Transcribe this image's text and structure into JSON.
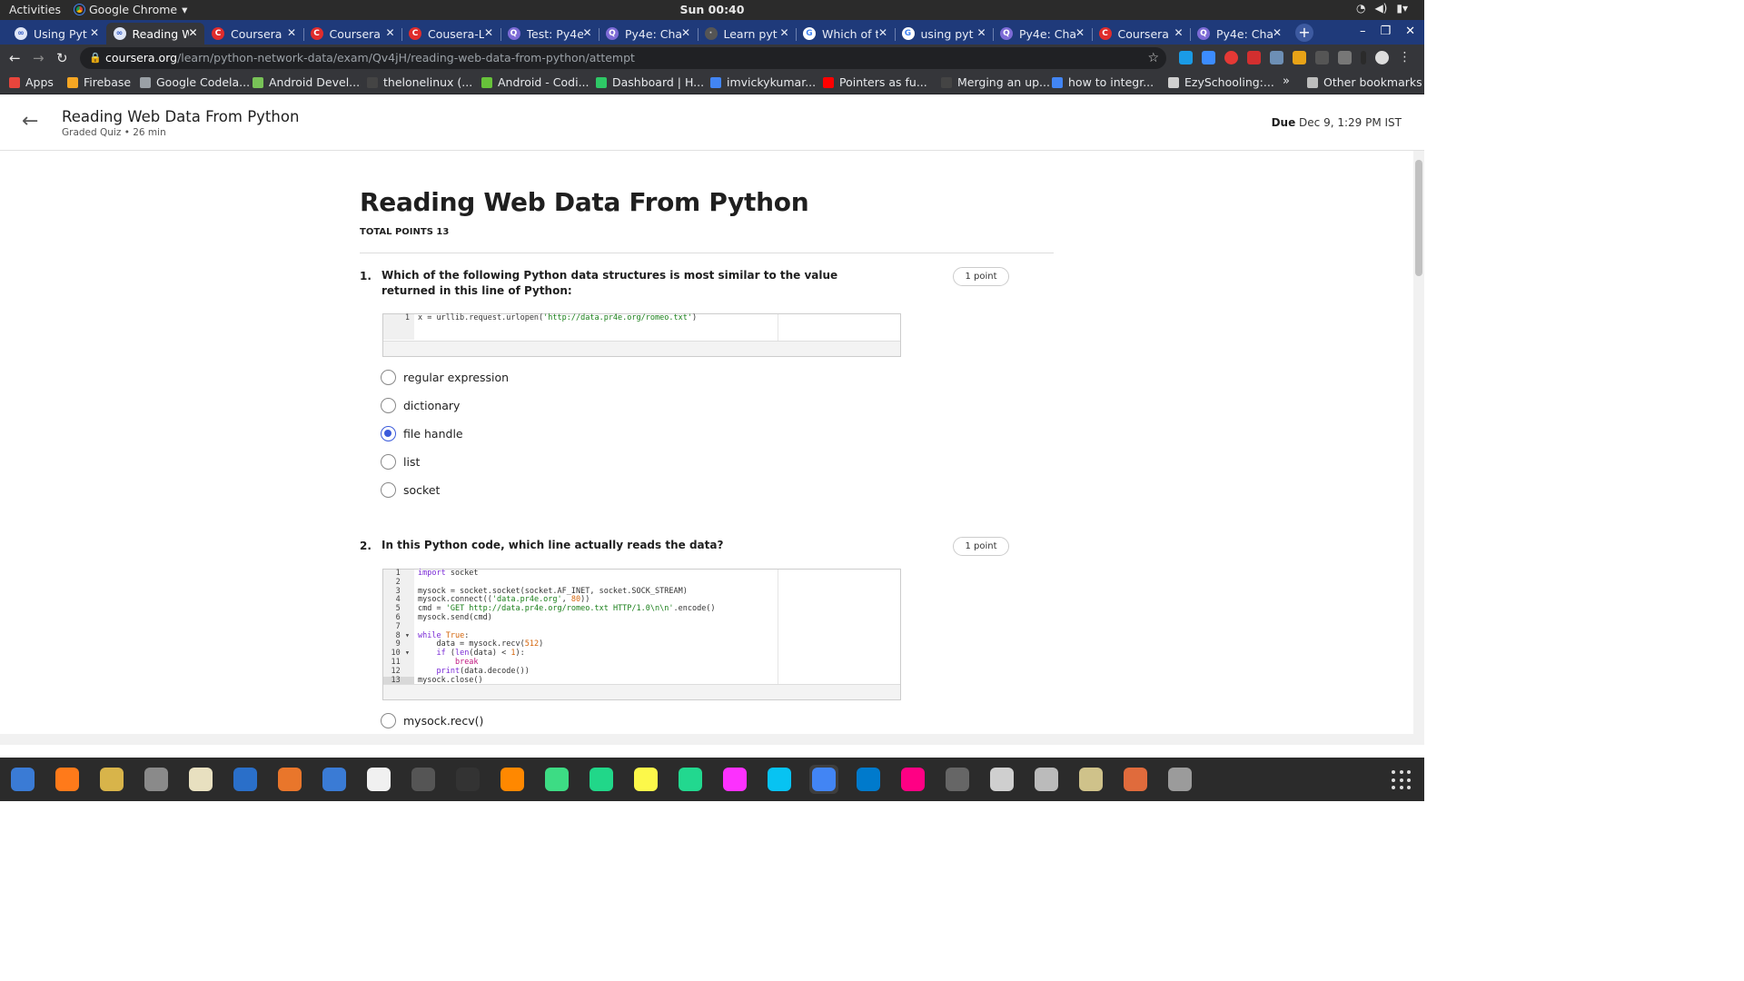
{
  "os": {
    "activities": "Activities",
    "app_name": "Google Chrome",
    "clock": "Sun 00:40"
  },
  "tabs": [
    {
      "label": "Using Pyt",
      "icon": "coursera-infinity-icon",
      "active": false
    },
    {
      "label": "Reading W",
      "icon": "coursera-infinity-icon",
      "active": true
    },
    {
      "label": "Coursera",
      "icon": "coursera-c-icon",
      "active": false
    },
    {
      "label": "Coursera",
      "icon": "coursera-c-icon",
      "active": false
    },
    {
      "label": "Cousera-L",
      "icon": "coursera-c-icon",
      "active": false
    },
    {
      "label": "Test: Py4e",
      "icon": "quiz-q-icon",
      "active": false
    },
    {
      "label": "Py4e: Cha",
      "icon": "quiz-q-icon",
      "active": false
    },
    {
      "label": "Learn pyt",
      "icon": "code-icon",
      "active": false
    },
    {
      "label": "Which of t",
      "icon": "google-icon",
      "active": false
    },
    {
      "label": "using pyt",
      "icon": "google-icon",
      "active": false
    },
    {
      "label": "Py4e: Cha",
      "icon": "quiz-q-icon",
      "active": false
    },
    {
      "label": "Coursera",
      "icon": "coursera-c-icon",
      "active": false
    },
    {
      "label": "Py4e: Cha",
      "icon": "quiz-q-icon",
      "active": false
    }
  ],
  "omnibox": {
    "host": "coursera.org",
    "path": "/learn/python-network-data/exam/Qv4jH/reading-web-data-from-python/attempt"
  },
  "bookmarks": {
    "items": [
      {
        "label": "Apps",
        "icon": "apps-grid-icon",
        "color": "#e8453c"
      },
      {
        "label": "Firebase",
        "icon": "firebase-icon",
        "color": "#f5a623"
      },
      {
        "label": "Google Codela...",
        "icon": "codelab-icon",
        "color": "#9aa0a6"
      },
      {
        "label": "Android Devel...",
        "icon": "android-icon",
        "color": "#78c257"
      },
      {
        "label": "thelonelinux (...",
        "icon": "github-icon",
        "color": "#444"
      },
      {
        "label": "Android - Codi...",
        "icon": "codinghub-icon",
        "color": "#67c23a"
      },
      {
        "label": "Dashboard | H...",
        "icon": "hackerearth-icon",
        "color": "#2ec866"
      },
      {
        "label": "imvickykumar...",
        "icon": "stats-icon",
        "color": "#4285f4"
      },
      {
        "label": "Pointers as fu...",
        "icon": "youtube-icon",
        "color": "#ff0000"
      },
      {
        "label": "Merging an up...",
        "icon": "github-icon",
        "color": "#444"
      },
      {
        "label": "how to integr...",
        "icon": "google-icon",
        "color": "#4285f4"
      },
      {
        "label": "EzySchooling:...",
        "icon": "ezyschooling-icon",
        "color": "#cfcfcf"
      }
    ],
    "more": "»",
    "other": "Other bookmarks"
  },
  "header": {
    "title": "Reading Web Data From Python",
    "subtitle": "Graded Quiz • 26 min",
    "due_label": "Due",
    "due_value": "Dec 9, 1:29 PM IST"
  },
  "quiz": {
    "title": "Reading Web Data From Python",
    "total_points": "TOTAL POINTS 13",
    "questions": [
      {
        "number": "1.",
        "text": "Which of the following Python data structures is most similar to the value returned in this line of Python:",
        "points": "1 point",
        "code_lines": [
          "x = urllib.request.urlopen('http://data.pr4e.org/romeo.txt')"
        ],
        "options": [
          "regular expression",
          "dictionary",
          "file handle",
          "list",
          "socket"
        ],
        "selected_option": "file handle"
      },
      {
        "number": "2.",
        "text": "In this Python code, which line actually reads the data?",
        "points": "1 point",
        "code_lines": [
          "import socket",
          "",
          "mysock = socket.socket(socket.AF_INET, socket.SOCK_STREAM)",
          "mysock.connect(('data.pr4e.org', 80))",
          "cmd = 'GET http://data.pr4e.org/romeo.txt HTTP/1.0\\n\\n'.encode()",
          "mysock.send(cmd)",
          "",
          "while True:",
          "    data = mysock.recv(512)",
          "    if (len(data) < 1):",
          "        break",
          "    print(data.decode())",
          "mysock.close()"
        ],
        "fold_lines": [
          8,
          10
        ],
        "options": [
          "mysock.recv()"
        ]
      }
    ]
  },
  "dock": {
    "apps": [
      {
        "icon": "thunderbird-icon",
        "color": "#3a7bd5"
      },
      {
        "icon": "firefox-icon",
        "color": "#ff7a1a"
      },
      {
        "icon": "rhythmbox-icon",
        "color": "#d8b44a"
      },
      {
        "icon": "files-icon",
        "color": "#8a8a8a"
      },
      {
        "icon": "text-editor-icon",
        "color": "#e8e0c0"
      },
      {
        "icon": "libreoffice-writer-icon",
        "color": "#2a6fc9"
      },
      {
        "icon": "software-center-icon",
        "color": "#e9762b"
      },
      {
        "icon": "help-icon",
        "color": "#3a7bd5"
      },
      {
        "icon": "amazon-icon",
        "color": "#f0f0f0"
      },
      {
        "icon": "video-editor-icon",
        "color": "#555"
      },
      {
        "icon": "terminal-icon",
        "color": "#333"
      },
      {
        "icon": "vlc-icon",
        "color": "#ff8800"
      },
      {
        "icon": "android-studio-icon",
        "color": "#3ddc84"
      },
      {
        "icon": "pycharm-icon",
        "color": "#21d789"
      },
      {
        "icon": "pycharm-pro-icon",
        "color": "#fcf84a"
      },
      {
        "icon": "clion-icon",
        "color": "#22d88f"
      },
      {
        "icon": "intellij-icon",
        "color": "#fc31fe"
      },
      {
        "icon": "webstorm-icon",
        "color": "#07c3f2"
      },
      {
        "icon": "chrome-icon",
        "color": "#4285f4"
      },
      {
        "icon": "vscode-icon",
        "color": "#007acc"
      },
      {
        "icon": "flickr-icon",
        "color": "#ff0084"
      },
      {
        "icon": "color-picker-icon",
        "color": "#666"
      },
      {
        "icon": "printer-icon",
        "color": "#cfcfcf"
      },
      {
        "icon": "scanner-icon",
        "color": "#bbbbbb"
      },
      {
        "icon": "image-viewer-icon",
        "color": "#cfc28a"
      },
      {
        "icon": "archive-manager-icon",
        "color": "#e06b3c"
      },
      {
        "icon": "cheese-webcam-icon",
        "color": "#9b9b9b"
      }
    ],
    "current": "chrome-icon"
  },
  "colors": {
    "accent": "#3b5bdb",
    "tabstrip": "#1f3a7a",
    "coursera": "#e02c2c"
  }
}
